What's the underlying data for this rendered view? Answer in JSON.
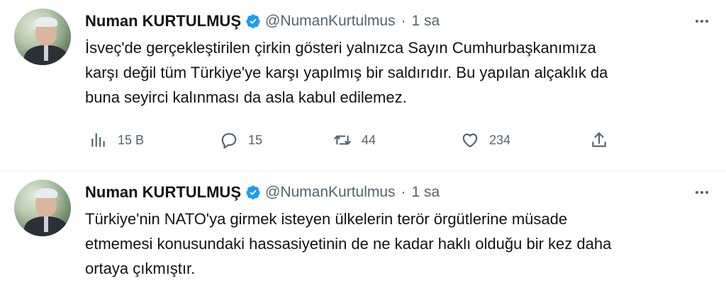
{
  "tweets": [
    {
      "author": {
        "name": "Numan KURTULMUŞ",
        "handle": "@NumanKurtulmus"
      },
      "separator": "·",
      "time": "1 sa",
      "text_lines": [
        "İsveç'de gerçekleştirilen çirkin gösteri yalnızca Sayın Cumhurbaşkanımıza",
        "karşı değil tüm Türkiye'ye karşı yapılmış bir saldırıdır. Bu yapılan alçaklık da",
        "buna seyirci kalınması da asla kabul edilemez."
      ],
      "stats": {
        "views": "15 B",
        "replies": "15",
        "retweets": "44",
        "likes": "234"
      }
    },
    {
      "author": {
        "name": "Numan KURTULMUŞ",
        "handle": "@NumanKurtulmus"
      },
      "separator": "·",
      "time": "1 sa",
      "text_lines": [
        "Türkiye'nin NATO'ya girmek isteyen ülkelerin terör örgütlerine müsade",
        "etmemesi konusundaki hassasiyetinin de ne kadar haklı olduğu bir kez daha",
        "ortaya çıkmıştır."
      ]
    }
  ],
  "icons": {
    "verified": "verified-badge-icon",
    "more": "more-horizontal-icon",
    "views": "analytics-icon",
    "reply": "reply-icon",
    "retweet": "retweet-icon",
    "like": "heart-icon",
    "share": "share-icon"
  },
  "colors": {
    "verified": "#1d9bf0",
    "text": "#0f1419",
    "secondary": "#536471",
    "divider": "#eff3f4"
  }
}
